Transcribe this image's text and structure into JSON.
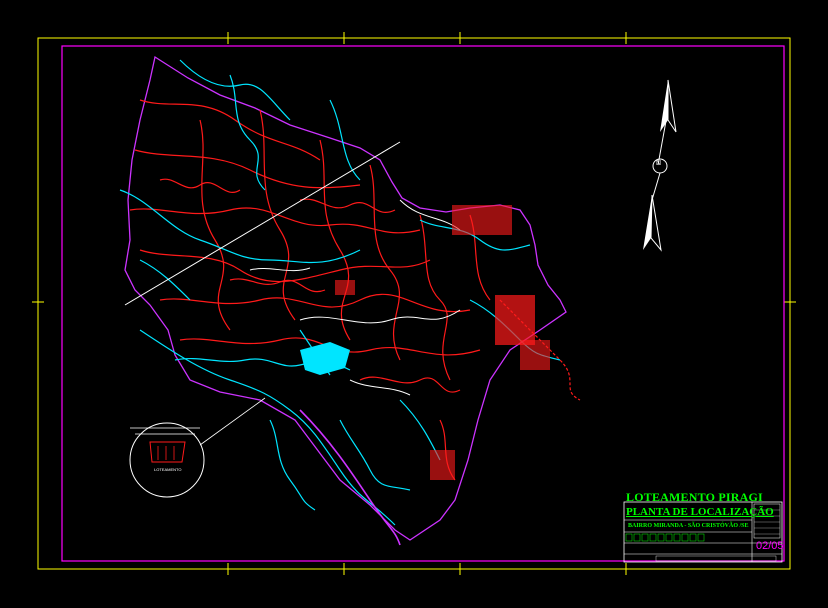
{
  "title_block": {
    "project": "LOTEAMENTO PIRAGI",
    "sheet_title": "PLANTA DE LOCALIZAÇÃO",
    "location": "BAIRRO MIRANDA - SÃO CRISTÓVÃO /SE",
    "sheet_number": "02/05"
  },
  "inset": {
    "label": "LOTEAMENTO"
  },
  "north_arrow": {
    "label": "N"
  },
  "colors": {
    "background": "#000000",
    "frame": "#ffff00",
    "border": "#ff00ff",
    "roads": "#ff0000",
    "rivers": "#00ffff",
    "paths": "#ffffff",
    "title_text": "#00ff00"
  },
  "icons": [
    "north-arrow-icon"
  ]
}
